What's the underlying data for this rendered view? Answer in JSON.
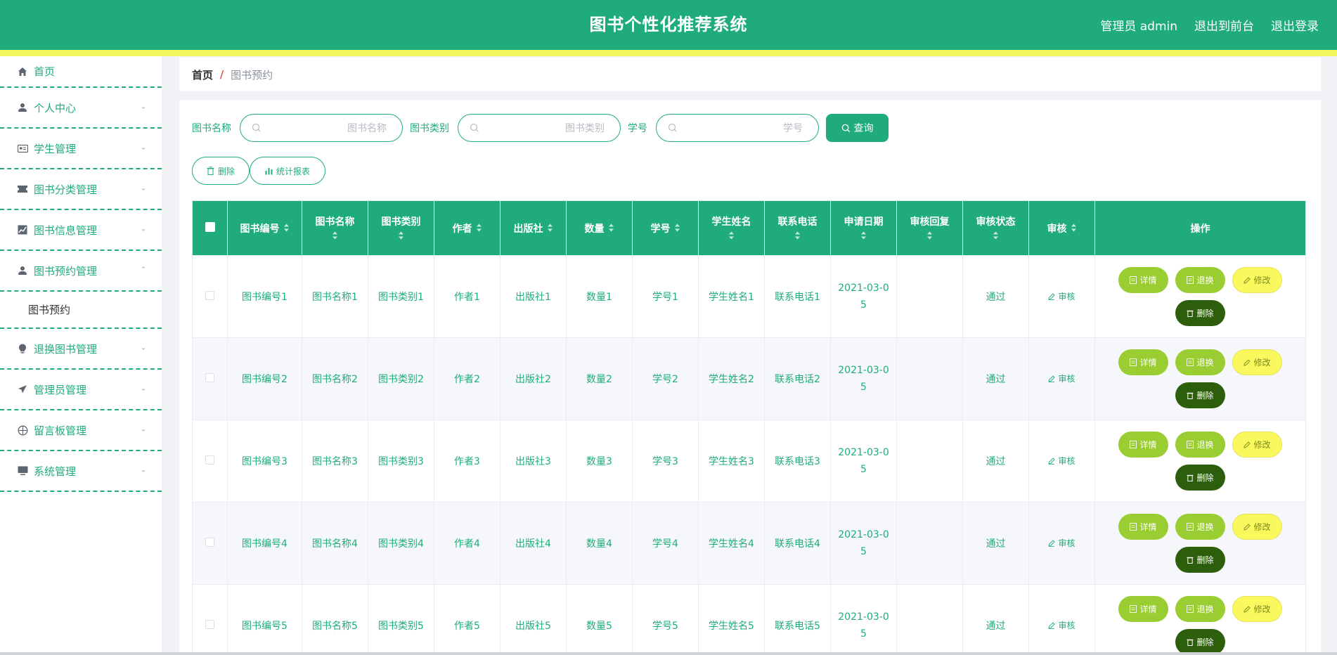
{
  "header": {
    "title": "图书个性化推荐系统",
    "user": "管理员 admin",
    "to_front": "退出到前台",
    "logout": "退出登录"
  },
  "sidebar": {
    "items": [
      {
        "label": "首页",
        "icon": "home-icon"
      },
      {
        "label": "个人中心",
        "icon": "user-icon"
      },
      {
        "label": "学生管理",
        "icon": "id-card-icon"
      },
      {
        "label": "图书分类管理",
        "icon": "ticket-icon"
      },
      {
        "label": "图书信息管理",
        "icon": "chart-icon"
      },
      {
        "label": "图书预约管理",
        "icon": "user-icon",
        "expanded": true,
        "children": [
          "图书预约"
        ]
      },
      {
        "label": "退换图书管理",
        "icon": "lightbulb-icon"
      },
      {
        "label": "管理员管理",
        "icon": "paper-plane-icon"
      },
      {
        "label": "留言板管理",
        "icon": "compass-icon"
      },
      {
        "label": "系统管理",
        "icon": "monitor-icon"
      }
    ]
  },
  "breadcrumb": {
    "home": "首页",
    "separator": "/",
    "current": "图书预约"
  },
  "search": {
    "book_name_label": "图书名称",
    "book_name_placeholder": "图书名称",
    "book_type_label": "图书类别",
    "book_type_placeholder": "图书类别",
    "student_no_label": "学号",
    "student_no_placeholder": "学号",
    "query_button": "查询"
  },
  "actions": {
    "delete": "删除",
    "report": "统计报表"
  },
  "table": {
    "columns": [
      "图书编号",
      "图书名称",
      "图书类别",
      "作者",
      "出版社",
      "数量",
      "学号",
      "学生姓名",
      "联系电话",
      "申请日期",
      "审核回复",
      "审核状态",
      "审核",
      "操作"
    ],
    "rows": [
      {
        "code": "图书编号1",
        "name": "图书名称1",
        "type": "图书类别1",
        "author": "作者1",
        "publisher": "出版社1",
        "qty": "数量1",
        "student_no": "学号1",
        "student_name": "学生姓名1",
        "phone": "联系电话1",
        "date": "2021-03-05",
        "reply": "",
        "status": "通过"
      },
      {
        "code": "图书编号2",
        "name": "图书名称2",
        "type": "图书类别2",
        "author": "作者2",
        "publisher": "出版社2",
        "qty": "数量2",
        "student_no": "学号2",
        "student_name": "学生姓名2",
        "phone": "联系电话2",
        "date": "2021-03-05",
        "reply": "",
        "status": "通过"
      },
      {
        "code": "图书编号3",
        "name": "图书名称3",
        "type": "图书类别3",
        "author": "作者3",
        "publisher": "出版社3",
        "qty": "数量3",
        "student_no": "学号3",
        "student_name": "学生姓名3",
        "phone": "联系电话3",
        "date": "2021-03-05",
        "reply": "",
        "status": "通过"
      },
      {
        "code": "图书编号4",
        "name": "图书名称4",
        "type": "图书类别4",
        "author": "作者4",
        "publisher": "出版社4",
        "qty": "数量4",
        "student_no": "学号4",
        "student_name": "学生姓名4",
        "phone": "联系电话4",
        "date": "2021-03-05",
        "reply": "",
        "status": "通过"
      },
      {
        "code": "图书编号5",
        "name": "图书名称5",
        "type": "图书类别5",
        "author": "作者5",
        "publisher": "出版社5",
        "qty": "数量5",
        "student_no": "学号5",
        "student_name": "学生姓名5",
        "phone": "联系电话5",
        "date": "2021-03-05",
        "reply": "",
        "status": "通过"
      }
    ],
    "audit_link": "审核",
    "row_buttons": {
      "detail": "详情",
      "return": "退换",
      "edit": "修改",
      "delete": "删除"
    }
  },
  "colors": {
    "primary": "#1fac7a",
    "stripe": "#f3f55f",
    "detail_btn": "#9acd32",
    "edit_btn": "#f9f85d",
    "delete_btn": "#2d5e0c"
  }
}
